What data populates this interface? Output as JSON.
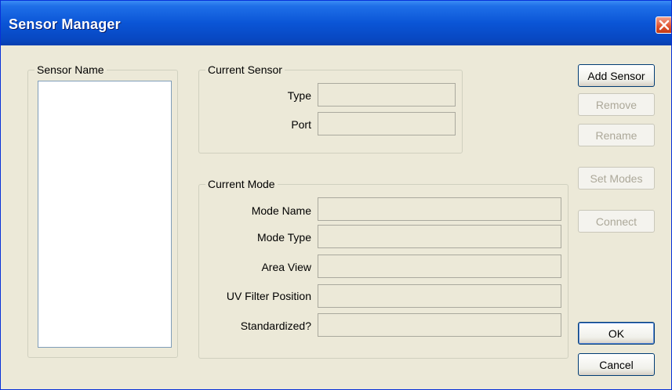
{
  "window": {
    "title": "Sensor Manager"
  },
  "sensor_list": {
    "group_label": "Sensor Name",
    "items": []
  },
  "current_sensor": {
    "group_label": "Current Sensor",
    "fields": [
      {
        "label": "Type",
        "value": ""
      },
      {
        "label": "Port",
        "value": ""
      }
    ]
  },
  "current_mode": {
    "group_label": "Current Mode",
    "fields": [
      {
        "label": "Mode Name",
        "value": ""
      },
      {
        "label": "Mode Type",
        "value": ""
      },
      {
        "label": "Area View",
        "value": ""
      },
      {
        "label": "UV Filter Position",
        "value": ""
      },
      {
        "label": "Standardized?",
        "value": ""
      }
    ]
  },
  "buttons": {
    "add_sensor": "Add Sensor",
    "remove": "Remove",
    "rename": "Rename",
    "set_modes": "Set Modes",
    "connect": "Connect",
    "ok": "OK",
    "cancel": "Cancel"
  },
  "icons": {
    "close": "close-icon"
  },
  "colors": {
    "titlebar": "#0a55d6",
    "window_bg": "#ece9d8",
    "close_button": "#e0512c"
  }
}
